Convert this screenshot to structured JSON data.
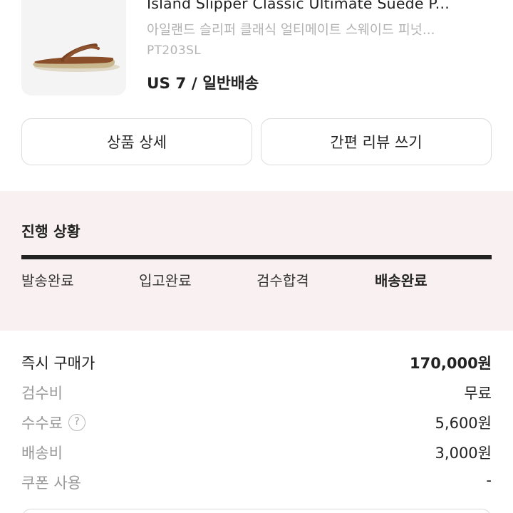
{
  "product": {
    "image_icon": "sandal-image",
    "title": "Island Slipper Classic Ultimate Suede P...",
    "subtitle": "아일랜드 슬리퍼 클래식 얼티메이트 스웨이드 피넛...",
    "code": "PT203SL",
    "option": "US 7 / 일반배송"
  },
  "buttons": {
    "detail": "상품 상세",
    "review": "간편 리뷰 쓰기"
  },
  "progress": {
    "title": "진행 상황",
    "steps": [
      "발송완료",
      "입고완료",
      "검수합격",
      "배송완료"
    ],
    "current_step": 3,
    "background_color": "#f9f1f1"
  },
  "pricing": {
    "rows": [
      {
        "label": "즉시 구매가",
        "value": "170,000원"
      },
      {
        "label": "검수비",
        "value": "무료"
      },
      {
        "label": "수수료",
        "value": "5,600원",
        "help_icon": "question-circle-icon",
        "help_symbol": "?"
      },
      {
        "label": "배송비",
        "value": "3,000원"
      },
      {
        "label": "쿠폰 사용",
        "value": "-"
      }
    ]
  }
}
